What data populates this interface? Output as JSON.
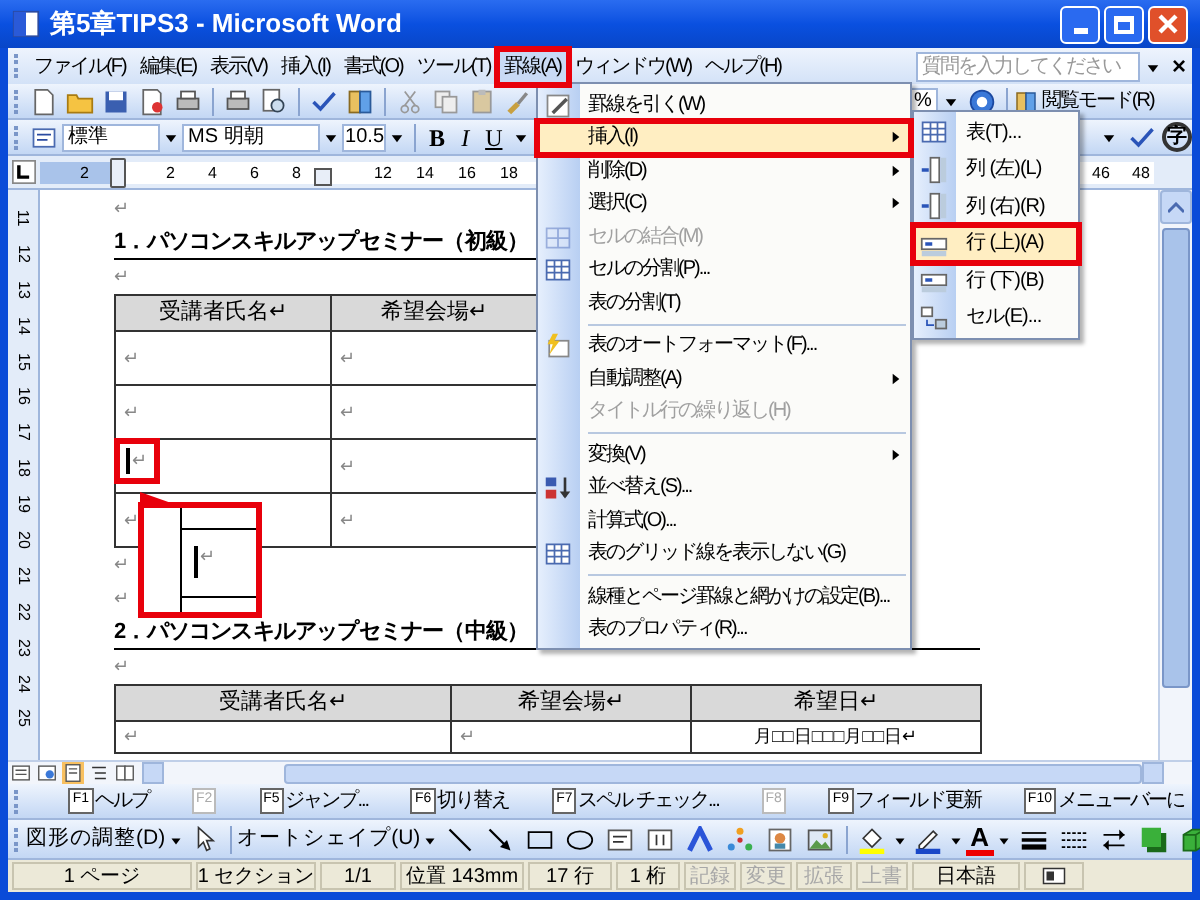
{
  "window": {
    "title": "第5章TIPS3 - Microsoft Word"
  },
  "menu_bar": {
    "items": [
      {
        "label": "ファイル(F)",
        "selected": false
      },
      {
        "label": "編集(E)",
        "selected": false
      },
      {
        "label": "表示(V)",
        "selected": false
      },
      {
        "label": "挿入(I)",
        "selected": false
      },
      {
        "label": "書式(O)",
        "selected": false
      },
      {
        "label": "ツール(T)",
        "selected": false
      },
      {
        "label": "罫線(A)",
        "selected": true
      },
      {
        "label": "ウィンドウ(W)",
        "selected": false
      },
      {
        "label": "ヘルプ(H)",
        "selected": false
      }
    ],
    "help_field": {
      "placeholder": "質問を入力してください"
    },
    "close_glyph": "×"
  },
  "standard_toolbar": {
    "zoom_value": "%",
    "reading_mode": "閲覧モード(R)"
  },
  "format_toolbar": {
    "style": "標準",
    "font": "MS 明朝",
    "size": "10.5",
    "bold": "B",
    "italic": "I",
    "underline": "U",
    "circled_char": "字"
  },
  "ruler": {
    "labels": [
      "2",
      "2",
      "4",
      "6",
      "8",
      "12",
      "14",
      "16",
      "18",
      "46",
      "48"
    ]
  },
  "vertical_ruler": {
    "labels": [
      "11",
      "12",
      "13",
      "14",
      "15",
      "16",
      "17",
      "18",
      "19",
      "20",
      "21",
      "22",
      "23",
      "24",
      "25"
    ]
  },
  "document": {
    "blocks": [
      {
        "kind": "mark",
        "text": "↵"
      },
      {
        "kind": "heading",
        "text": "1．パソコンスキルアップセミナー（初級）"
      },
      {
        "kind": "mark",
        "text": "↵"
      },
      {
        "kind": "table",
        "columns": [
          "受講者氏名↵",
          "希望会場↵"
        ],
        "rows": [
          [
            {
              "text": "↵",
              "cursor": false
            },
            {
              "text": "↵",
              "cursor": false
            }
          ],
          [
            {
              "text": "↵",
              "cursor": false
            },
            {
              "text": "↵",
              "cursor": false
            }
          ],
          [
            {
              "text": "↵",
              "cursor": true
            },
            {
              "text": "↵",
              "cursor": false
            }
          ],
          [
            {
              "text": "↵",
              "cursor": false
            },
            {
              "text": "↵",
              "cursor": false
            }
          ]
        ]
      },
      {
        "kind": "mark",
        "text": "↵"
      },
      {
        "kind": "mark",
        "text": "↵"
      },
      {
        "kind": "heading",
        "text": "2．パソコンスキルアップセミナー（中級）"
      },
      {
        "kind": "mark",
        "text": "↵"
      },
      {
        "kind": "table",
        "columns": [
          "受講者氏名↵",
          "希望会場↵",
          "希望日↵"
        ],
        "rows": [
          [
            {
              "text": "↵",
              "cursor": false
            },
            {
              "text": "↵",
              "cursor": false
            },
            {
              "text": "月□□日□□□月□□日↵",
              "cursor": false
            }
          ]
        ]
      }
    ],
    "callout": {
      "mark": "↵"
    }
  },
  "table_menu": {
    "items": [
      {
        "label": "罫線を引く(W)",
        "selected": false,
        "disabled": false,
        "submenu": false,
        "separator_before": false
      },
      {
        "label": "挿入(I)",
        "selected": true,
        "disabled": false,
        "submenu": true,
        "separator_before": false
      },
      {
        "label": "削除(D)",
        "selected": false,
        "disabled": false,
        "submenu": true,
        "separator_before": false
      },
      {
        "label": "選択(C)",
        "selected": false,
        "disabled": false,
        "submenu": true,
        "separator_before": false
      },
      {
        "label": "セルの結合(M)",
        "selected": false,
        "disabled": true,
        "submenu": false,
        "separator_before": false
      },
      {
        "label": "セルの分割(P)...",
        "selected": false,
        "disabled": false,
        "submenu": false,
        "separator_before": false
      },
      {
        "label": "表の分割(T)",
        "selected": false,
        "disabled": false,
        "submenu": false,
        "separator_before": false
      },
      {
        "label": "表のオートフォーマット(F)...",
        "selected": false,
        "disabled": false,
        "submenu": false,
        "separator_before": true
      },
      {
        "label": "自動調整(A)",
        "selected": false,
        "disabled": false,
        "submenu": true,
        "separator_before": false
      },
      {
        "label": "タイトル行の繰り返し(H)",
        "selected": false,
        "disabled": true,
        "submenu": false,
        "separator_before": false
      },
      {
        "label": "変換(V)",
        "selected": false,
        "disabled": false,
        "submenu": true,
        "separator_before": true
      },
      {
        "label": "並べ替え(S)...",
        "selected": false,
        "disabled": false,
        "submenu": false,
        "separator_before": false
      },
      {
        "label": "計算式(O)...",
        "selected": false,
        "disabled": false,
        "submenu": false,
        "separator_before": false
      },
      {
        "label": "表のグリッド線を表示しない(G)",
        "selected": false,
        "disabled": false,
        "submenu": false,
        "separator_before": false
      },
      {
        "label": "線種とページ罫線と網かけの設定(B)...",
        "selected": false,
        "disabled": false,
        "submenu": false,
        "separator_before": true
      },
      {
        "label": "表のプロパティ(R)...",
        "selected": false,
        "disabled": false,
        "submenu": false,
        "separator_before": false
      }
    ]
  },
  "insert_submenu": {
    "items": [
      {
        "label": "表(T)...",
        "selected": false
      },
      {
        "label": "列 (左)(L)",
        "selected": false
      },
      {
        "label": "列 (右)(R)",
        "selected": false
      },
      {
        "label": "行 (上)(A)",
        "selected": true
      },
      {
        "label": "行 (下)(B)",
        "selected": false
      },
      {
        "label": "セル(E)...",
        "selected": false
      }
    ]
  },
  "function_keys": [
    {
      "key": "F1",
      "label": "ヘルプ",
      "disabled": false
    },
    {
      "key": "F2",
      "disabled": true
    },
    {
      "key": "F5",
      "label": "ジャンプ...",
      "disabled": false
    },
    {
      "key": "F6",
      "label": "切り替え",
      "disabled": false
    },
    {
      "key": "F7",
      "label": "スペル チェック...",
      "disabled": false
    },
    {
      "key": "F8",
      "disabled": true
    },
    {
      "key": "F9",
      "label": "フィールド更新",
      "disabled": false
    },
    {
      "key": "F10",
      "label": "メニューバーに",
      "disabled": false
    }
  ],
  "drawing_toolbar": {
    "arrange": "図形の調整(D)",
    "autoshapes": "オートシェイプ(U)",
    "font_color_glyph": "A"
  },
  "status_bar": {
    "cells": [
      {
        "text": "1 ページ",
        "disabled": false
      },
      {
        "text": "1 セクション",
        "disabled": false
      },
      {
        "text": "1/1",
        "disabled": false
      },
      {
        "text": "位置 143mm",
        "disabled": false
      },
      {
        "text": "17 行",
        "disabled": false
      },
      {
        "text": "1 桁",
        "disabled": false
      },
      {
        "text": "記録",
        "disabled": true
      },
      {
        "text": "変更",
        "disabled": true
      },
      {
        "text": "拡張",
        "disabled": true
      },
      {
        "text": "上書",
        "disabled": true
      },
      {
        "text": "日本語",
        "disabled": false
      }
    ]
  }
}
